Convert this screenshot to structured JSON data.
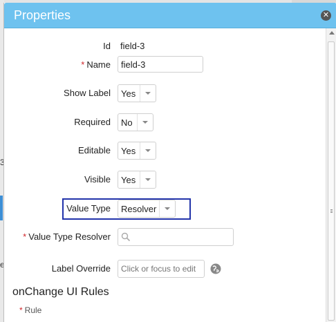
{
  "dialog": {
    "title": "Properties",
    "close_icon": "close-icon"
  },
  "fields": {
    "id": {
      "label": "Id",
      "value": "field-3"
    },
    "name": {
      "label": "Name",
      "required_mark": "*",
      "value": "field-3"
    },
    "show_label": {
      "label": "Show Label",
      "value": "Yes"
    },
    "required": {
      "label": "Required",
      "value": "No"
    },
    "editable": {
      "label": "Editable",
      "value": "Yes"
    },
    "visible": {
      "label": "Visible",
      "value": "Yes"
    },
    "value_type": {
      "label": "Value Type",
      "value": "Resolver"
    },
    "value_type_resolver": {
      "label": "Value Type Resolver",
      "required_mark": "*",
      "value": ""
    },
    "label_override": {
      "label": "Label Override",
      "placeholder": "Click or focus to edit"
    }
  },
  "onchange": {
    "title": "onChange UI Rules",
    "rule_label": "Rule",
    "required_mark": "*"
  },
  "colors": {
    "titlebar": "#6ec2ef",
    "required": "#d0252a",
    "highlight": "#2233aa"
  },
  "background": {
    "left_chars": [
      "3",
      "e"
    ]
  }
}
